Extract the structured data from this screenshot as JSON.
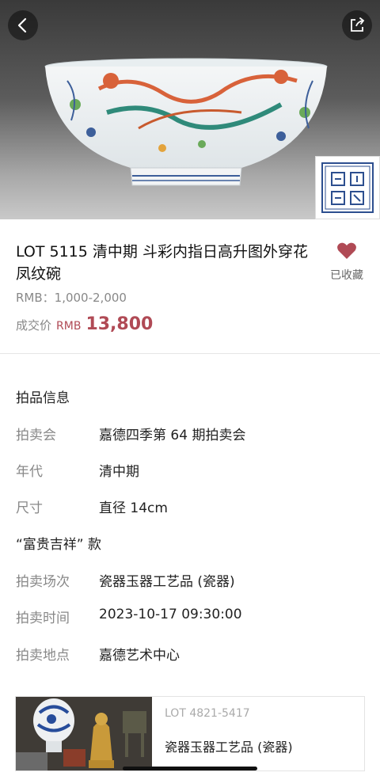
{
  "lot": {
    "title": "LOT 5115 清中期 斗彩内指日高升图外穿花凤纹碗",
    "estimate": "RMB：1,000-2,000",
    "deal_label": "成交价",
    "deal_currency": "RMB",
    "deal_amount": "13,800",
    "fav_label": "已收藏",
    "fav_icon": "heart-icon",
    "accent_color": "#b04a55"
  },
  "details": {
    "section_title": "拍品信息",
    "rows": [
      {
        "key": "拍卖会",
        "value": "嘉德四季第 64 期拍卖会"
      },
      {
        "key": "年代",
        "value": "清中期"
      },
      {
        "key": "尺寸",
        "value": "直径 14cm"
      }
    ],
    "note": "“富贵吉祥” 款",
    "rows2": [
      {
        "key": "拍卖场次",
        "value": "瓷器玉器工艺品 (瓷器)"
      },
      {
        "key": "拍卖时间",
        "value": "2023-10-17 09:30:00"
      },
      {
        "key": "拍卖地点",
        "value": "嘉德艺术中心"
      }
    ]
  },
  "related": {
    "lot_range": "LOT 4821-5417",
    "category": "瓷器玉器工艺品 (瓷器)"
  },
  "icons": {
    "back": "back-arrow-icon",
    "share": "share-icon"
  }
}
